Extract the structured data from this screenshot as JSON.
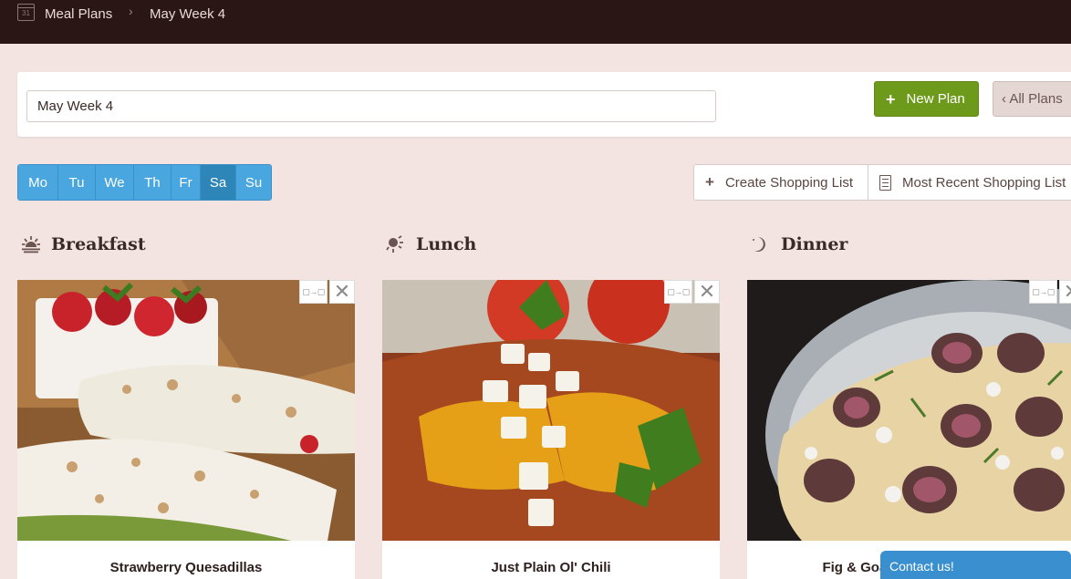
{
  "breadcrumb": {
    "calendar_icon_text": "31",
    "items": [
      "Meal Plans",
      "May Week 4"
    ],
    "separator": "›"
  },
  "plan": {
    "name_value": "May Week 4",
    "new_plan_label": "New Plan",
    "all_plans_label": "‹ All Plans"
  },
  "days": [
    {
      "label": "Mo",
      "active": false
    },
    {
      "label": "Tu",
      "active": false
    },
    {
      "label": "We",
      "active": false
    },
    {
      "label": "Th",
      "active": false
    },
    {
      "label": "Fr",
      "active": false
    },
    {
      "label": "Sa",
      "active": true
    },
    {
      "label": "Su",
      "active": false
    }
  ],
  "shopping": {
    "create_label": "Create Shopping List",
    "recent_label": "Most Recent Shopping List"
  },
  "meals": [
    {
      "label": "Breakfast",
      "icon": "sunrise-icon",
      "recipe": "Strawberry Quesadillas"
    },
    {
      "label": "Lunch",
      "icon": "sun-icon",
      "recipe": "Just Plain Ol' Chili"
    },
    {
      "label": "Dinner",
      "icon": "moon-icon",
      "recipe": "Fig & Goat Cheese Flatbread"
    }
  ],
  "card_controls": {
    "swap_label": "▢→▢",
    "close_label": "✕"
  },
  "contact_label": "Contact us!",
  "colors": {
    "topbar": "#2a1715",
    "background": "#f3e4e2",
    "primary_green": "#6e9a1b",
    "day_blue": "#4aa6de",
    "day_active": "#2e86b8",
    "contact_blue": "#3a8fcf"
  }
}
